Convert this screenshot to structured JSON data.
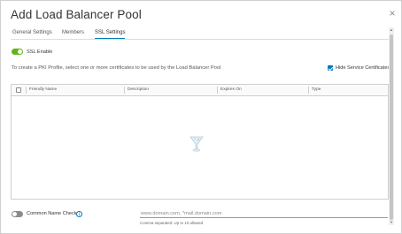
{
  "dialog": {
    "title": "Add Load Balancer Pool",
    "close_glyph": "×"
  },
  "tabs": [
    {
      "label": "General Settings",
      "active": false
    },
    {
      "label": "Members",
      "active": false
    },
    {
      "label": "SSL Settings",
      "active": true
    }
  ],
  "ssl": {
    "enable_label": "SSL Enable",
    "enabled": true,
    "instructions": "To create a PKI Profile, select one or more certificates to be used by the Load Balancer Pool",
    "hide_service_certs_label": "Hide Service Certificates",
    "hide_service_certs_checked": true
  },
  "grid": {
    "columns": [
      "Friendly Name",
      "Description",
      "Expires On",
      "Type"
    ],
    "rows": [],
    "empty_icon": "empty-placeholder-icon"
  },
  "common_name": {
    "toggle_label": "Common Name Check",
    "enabled": false,
    "info_glyph": "i",
    "input_placeholder": "www.domain.com, *mail.domain.com",
    "input_value": "",
    "helper_text": "Comma separated. Up to 10 allowed"
  },
  "colors": {
    "accent": "#0079b8",
    "toggle_on": "#60b515",
    "toggle_off": "#8c8c8c"
  }
}
